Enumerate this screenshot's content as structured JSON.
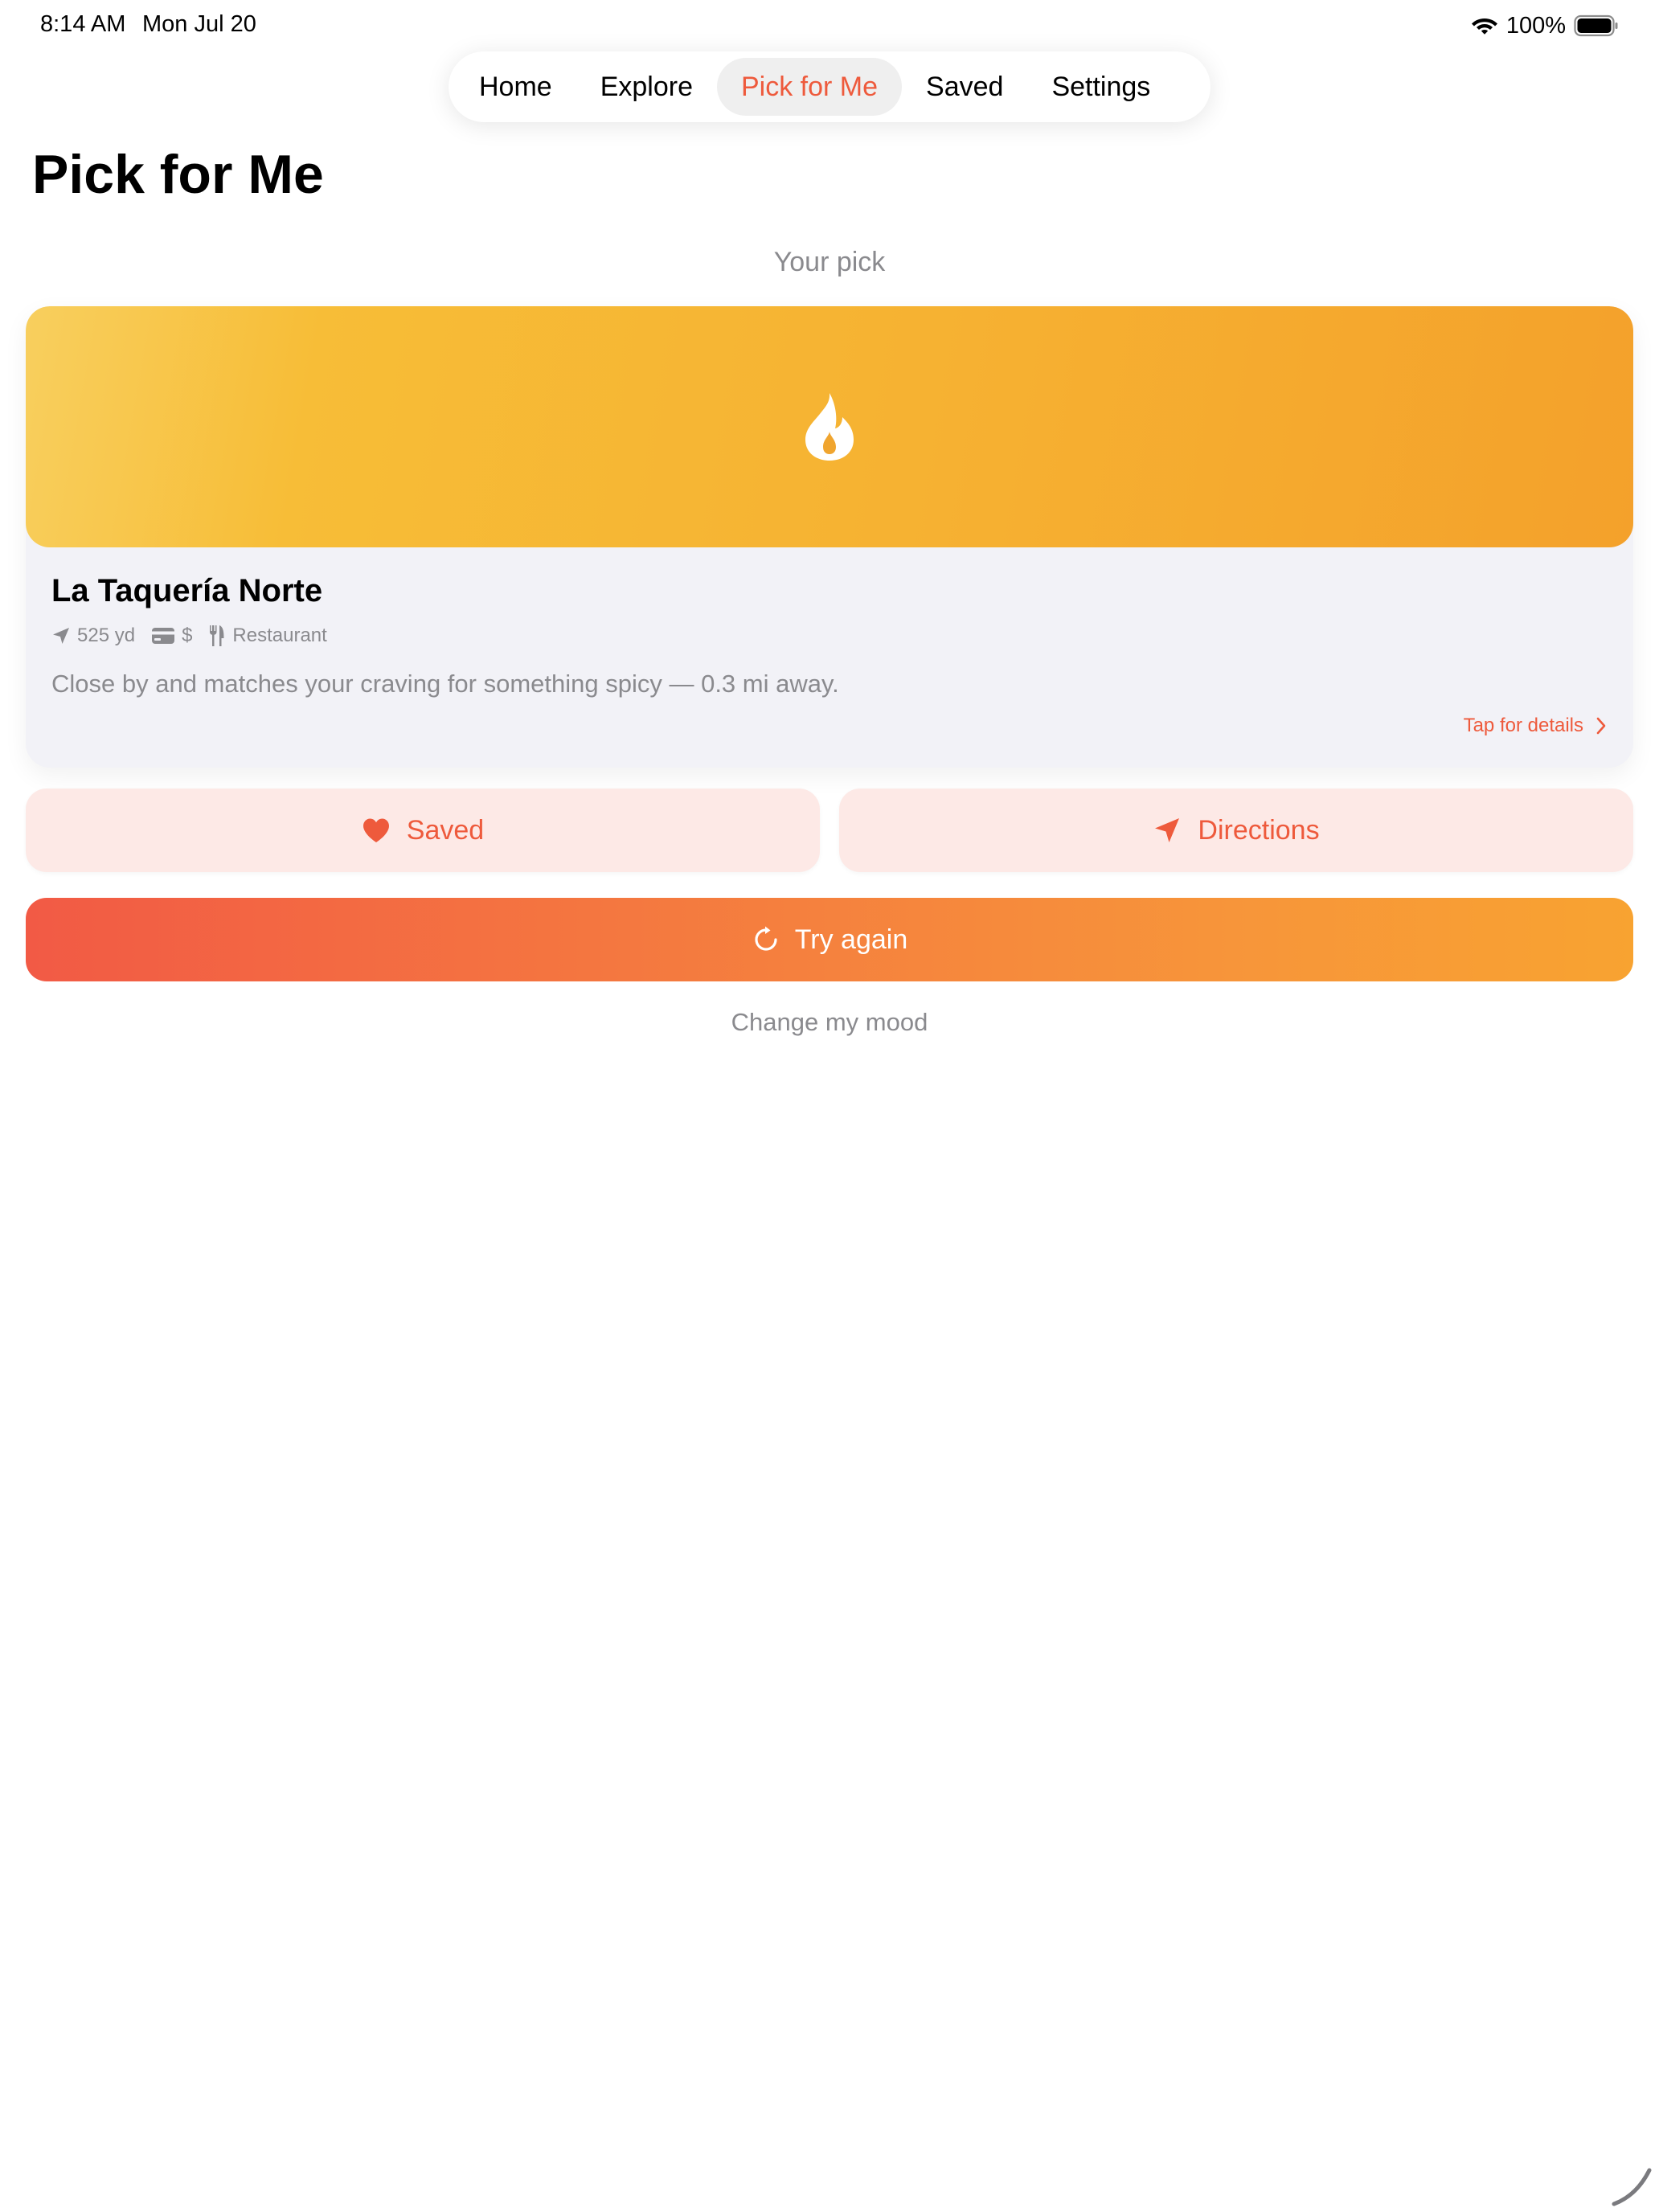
{
  "status_bar": {
    "time": "8:14 AM",
    "date": "Mon Jul 20",
    "battery": "100%"
  },
  "tabs": [
    {
      "label": "Home",
      "active": false
    },
    {
      "label": "Explore",
      "active": false
    },
    {
      "label": "Pick for Me",
      "active": true
    },
    {
      "label": "Saved",
      "active": false
    },
    {
      "label": "Settings",
      "active": false
    }
  ],
  "page": {
    "title": "Pick for Me",
    "section_label": "Your pick"
  },
  "card": {
    "name": "La Taquería Norte",
    "distance": "525 yd",
    "price": "$",
    "category": "Restaurant",
    "description": "Close by and matches your craving for something spicy — 0.3 mi away.",
    "details_link": "Tap for details",
    "banner_icon": "flame-icon"
  },
  "actions": {
    "saved_label": "Saved",
    "directions_label": "Directions",
    "try_again_label": "Try again",
    "change_mood_label": "Change my mood"
  },
  "colors": {
    "accent": "#ee5a3c",
    "button_tint": "#fde9e6",
    "card_bg": "#f2f2f7",
    "secondary_text": "#8a8a8e"
  }
}
